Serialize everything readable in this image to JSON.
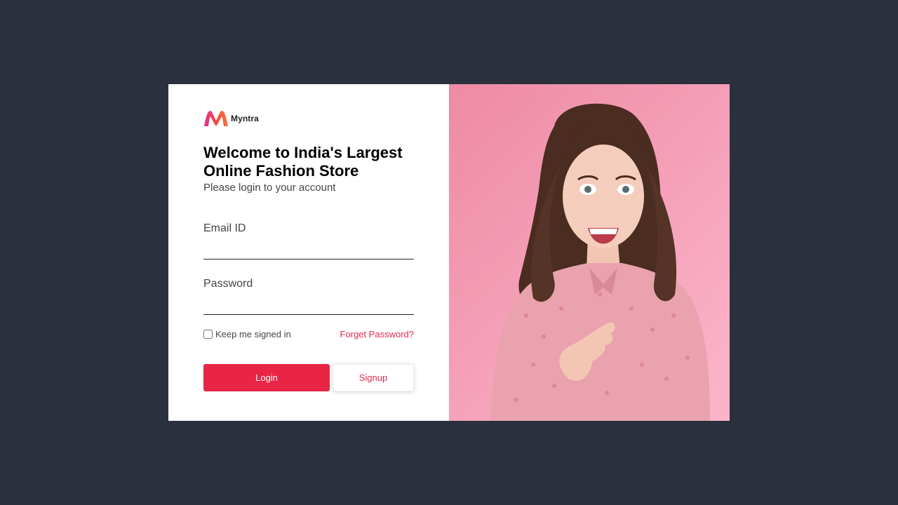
{
  "brand": {
    "name": "Myntra",
    "primary_color": "#e92545",
    "link_color": "#e0294a",
    "logo_colors": [
      "#ea2c8c",
      "#f36b3a",
      "#ff9a3c"
    ]
  },
  "login": {
    "title": "Welcome to India's Largest Online Fashion Store",
    "subtitle": "Please login to your account",
    "email_label": "Email ID",
    "email_value": "",
    "password_label": "Password",
    "password_value": "",
    "remember_label": "Keep me signed in",
    "remember_checked": false,
    "forgot_label": "Forget Password?",
    "login_button": "Login",
    "signup_button": "Signup"
  },
  "hero": {
    "image": "smiling-woman-pink-background",
    "background_color": "#f49ab4"
  }
}
